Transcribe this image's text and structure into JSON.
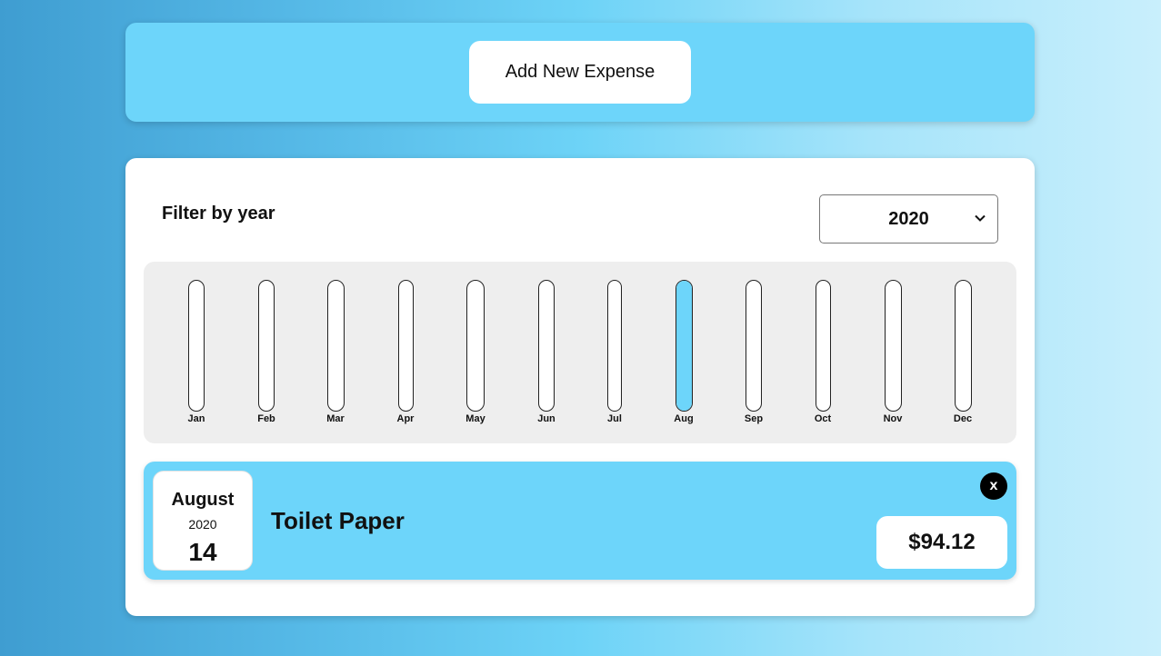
{
  "header": {
    "add_button_label": "Add New Expense"
  },
  "filter": {
    "label": "Filter by year",
    "selected_year": "2020"
  },
  "chart_data": {
    "type": "bar",
    "categories": [
      "Jan",
      "Feb",
      "Mar",
      "Apr",
      "May",
      "Jun",
      "Jul",
      "Aug",
      "Sep",
      "Oct",
      "Nov",
      "Dec"
    ],
    "values": [
      0,
      0,
      0,
      0,
      0,
      0,
      0,
      1,
      0,
      0,
      0,
      0
    ],
    "fill_color": "#6dd5fa"
  },
  "expenses": [
    {
      "month": "August",
      "year": "2020",
      "day": "14",
      "title": "Toilet Paper",
      "amount": "$94.12",
      "delete_label": "x"
    }
  ],
  "colors": {
    "accent": "#6dd5fa",
    "chart_bg": "#eeeeee"
  },
  "icons": {
    "select": "chevron-down-icon"
  }
}
